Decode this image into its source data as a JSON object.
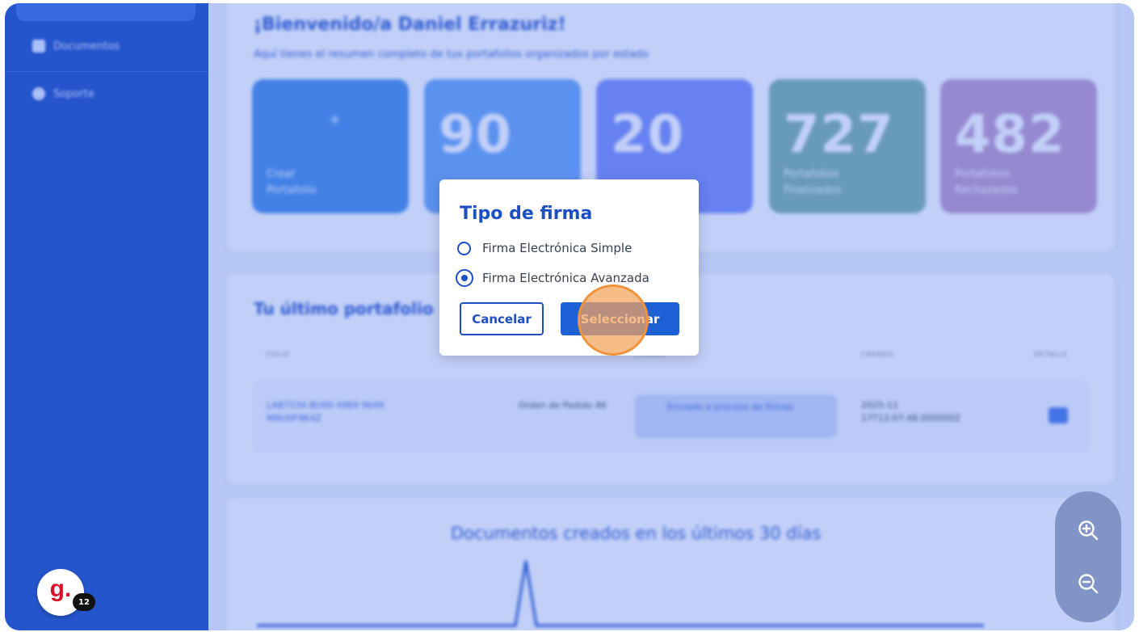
{
  "sidebar": {
    "items": [
      {
        "label": "Documentos",
        "icon": "document-icon"
      },
      {
        "label": "Soporte",
        "icon": "support-icon"
      }
    ]
  },
  "dashboard": {
    "welcome_title": "¡Bienvenido/a Daniel Errazuriz!",
    "welcome_subtitle": "Aquí tienes el resumen completo de tus portafolios organizados por estado",
    "stats": [
      {
        "value": "",
        "label": "Crear Portafolio",
        "color": "#4a8fe6"
      },
      {
        "value": "90",
        "label": "",
        "color": "#6ca6f3"
      },
      {
        "value": "20",
        "label": "",
        "color": "#7c8ff5"
      },
      {
        "value": "727",
        "label": "Portafolios Finalizados",
        "color": "#7fb3a4"
      },
      {
        "value": "482",
        "label": "Portafolios Rechazados",
        "color": "#c09ac8"
      }
    ],
    "last_portfolio_title": "Tu último portafolio",
    "table_headers": [
      "FOLIO",
      "",
      "ESTADO",
      "CREADO",
      "DETALLE"
    ],
    "table_row": {
      "name": "LAB7534 BU00 4969 9649 MNU0F9K4Z",
      "type": "Orden de Pedido 46",
      "status": "Enviado a proceso de firmas",
      "created": "2025-11 17T12:07:48.000000Z"
    },
    "chart_title": "Documentos creados en los últimos 30 días"
  },
  "dialog": {
    "title": "Tipo de firma",
    "options": [
      {
        "label": "Firma Electrónica Simple",
        "checked": false
      },
      {
        "label": "Firma Electrónica Avanzada",
        "checked": true
      }
    ],
    "cancel_label": "Cancelar",
    "select_label": "Seleccionar"
  },
  "zoom": {
    "in_icon": "zoom-in-icon",
    "out_icon": "zoom-out-icon"
  },
  "avatar": {
    "letter": "g.",
    "badge": "12"
  },
  "colors": {
    "primary": "#1d4fc4",
    "sidebar": "#1f4fc1",
    "overlay": "#3462e8",
    "marker": "#f4a45c"
  }
}
